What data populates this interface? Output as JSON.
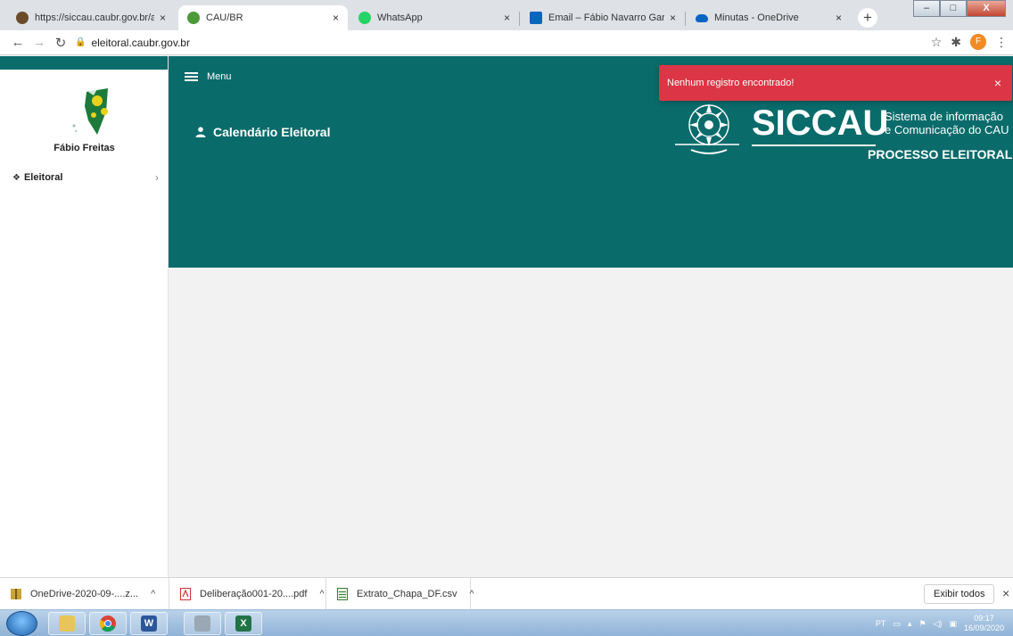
{
  "browser": {
    "tabs": [
      {
        "title": "https://siccau.caubr.gov.br/app/",
        "favicon": "globe-icon",
        "active": false
      },
      {
        "title": "CAU/BR",
        "favicon": "cau-icon",
        "active": true
      },
      {
        "title": "WhatsApp",
        "favicon": "whatsapp-icon",
        "active": false
      },
      {
        "title": "Email – Fábio Navarro Garcia de",
        "favicon": "outlook-icon",
        "active": false
      },
      {
        "title": "Minutas - OneDrive",
        "favicon": "onedrive-icon",
        "active": false
      }
    ],
    "close_glyph": "×",
    "new_tab_glyph": "+",
    "window_controls": {
      "minimize": "–",
      "maximize": "□",
      "close": "X"
    },
    "url": "eleitoral.caubr.gov.br",
    "profile_initial": "F"
  },
  "sidebar": {
    "user_name": "Fábio Freitas",
    "items": [
      {
        "label": "Eleitoral",
        "icon": "home-icon"
      }
    ]
  },
  "header": {
    "menu_label": "Menu",
    "page_title": "Calendário Eleitoral",
    "brand": {
      "name": "SICCAU",
      "tagline_line1": "Sistema de informação",
      "tagline_line2": "e Comunicação do CAU",
      "subtitle": "PROCESSO ELEITORAL"
    }
  },
  "toast": {
    "message": "Nenhum registro encontrado!",
    "close_glyph": "×",
    "color": "#dc3545"
  },
  "downloads": {
    "items": [
      {
        "name": "OneDrive-2020-09-....z...",
        "icon": "zip-icon"
      },
      {
        "name": "Deliberação001-20....pdf",
        "icon": "pdf-icon"
      },
      {
        "name": "Extrato_Chapa_DF.csv",
        "icon": "csv-icon"
      }
    ],
    "show_all_label": "Exibir todos",
    "close_glyph": "×"
  },
  "taskbar": {
    "apps": [
      {
        "name": "explorer",
        "icon": "folder-icon"
      },
      {
        "name": "chrome",
        "icon": "chrome-icon"
      },
      {
        "name": "word",
        "icon": "word-icon",
        "glyph": "W"
      },
      {
        "name": "calculator",
        "icon": "calculator-icon"
      },
      {
        "name": "excel",
        "icon": "excel-icon",
        "glyph": "X"
      }
    ],
    "tray_language": "PT",
    "clock_time": "09:17",
    "clock_date": "16/09/2020"
  },
  "colors": {
    "brand_teal": "#0a6b6b",
    "page_bg": "#f2f2f2"
  }
}
